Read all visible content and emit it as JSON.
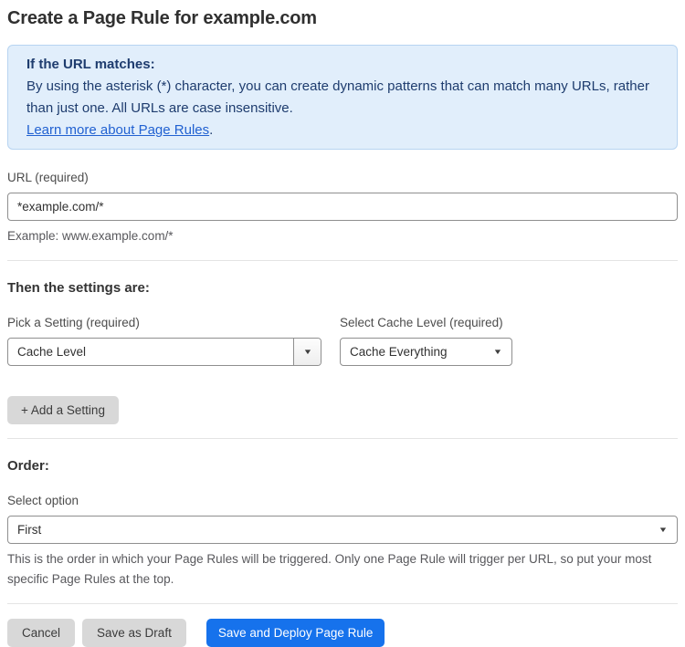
{
  "page": {
    "title": "Create a Page Rule for example.com"
  },
  "info_box": {
    "heading": "If the URL matches:",
    "body": "By using the asterisk (*) character, you can create dynamic patterns that can match many URLs, rather than just one. All URLs are case insensitive.",
    "link_label": "Learn more about Page Rules",
    "link_suffix": "."
  },
  "url_field": {
    "label": "URL (required)",
    "value": "*example.com/*",
    "helper": "Example: www.example.com/*"
  },
  "settings_section": {
    "heading": "Then the settings are:",
    "setting_picker": {
      "label": "Pick a Setting (required)",
      "value": "Cache Level"
    },
    "cache_level_picker": {
      "label": "Select Cache Level (required)",
      "value": "Cache Everything"
    },
    "add_setting_label": "+ Add a Setting"
  },
  "order_section": {
    "heading": "Order:",
    "select_label": "Select option",
    "value": "First",
    "helper": "This is the order in which your Page Rules will be triggered. Only one Page Rule will trigger per URL, so put your most specific Page Rules at the top."
  },
  "actions": {
    "cancel": "Cancel",
    "save_draft": "Save as Draft",
    "save_deploy": "Save and Deploy Page Rule"
  },
  "icons": {
    "dropdown_arrow": "▼"
  },
  "colors": {
    "info_bg": "#e1eefb",
    "info_border": "#b7d4f1",
    "info_text": "#1e3c6e",
    "link": "#2161d1",
    "primary_button": "#1672ec",
    "gray_button": "#d8d8d8",
    "divider": "#e4e4e4"
  }
}
